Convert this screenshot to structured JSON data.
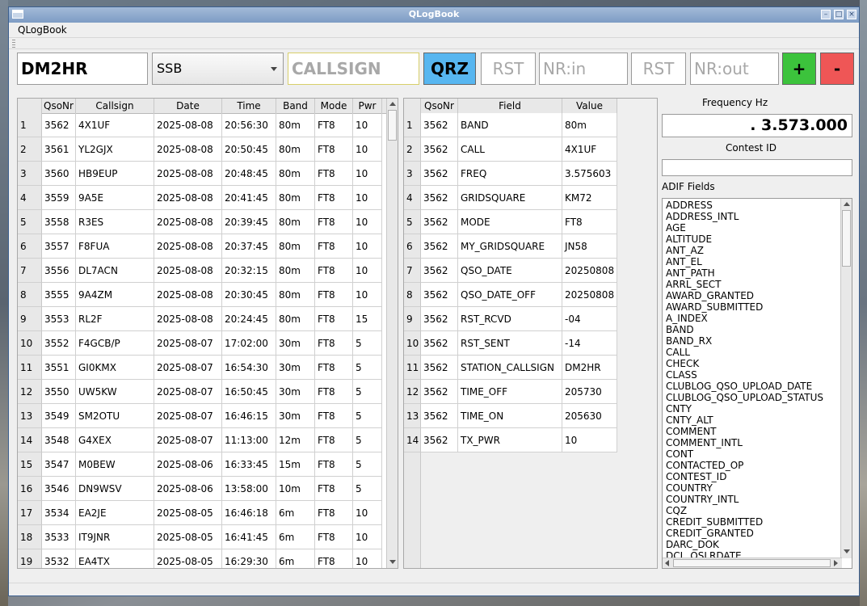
{
  "window": {
    "title": "QLogBook"
  },
  "menu": {
    "items": [
      "QLogBook"
    ]
  },
  "entry": {
    "station_call": "DM2HR",
    "mode_selected": "SSB",
    "callsign_placeholder": "CALLSIGN",
    "qrz_label": "QRZ",
    "rst_in_placeholder": "RST",
    "nr_in_placeholder": "NR:in",
    "rst_out_placeholder": "RST",
    "nr_out_placeholder": "NR:out",
    "add_label": "+",
    "remove_label": "-"
  },
  "log_table": {
    "columns": [
      "QsoNr",
      "Callsign",
      "Date",
      "Time",
      "Band",
      "Mode",
      "Pwr"
    ],
    "rows": [
      [
        "1",
        "3562",
        "4X1UF",
        "2025-08-08",
        "20:56:30",
        "80m",
        "FT8",
        "10"
      ],
      [
        "2",
        "3561",
        "YL2GJX",
        "2025-08-08",
        "20:50:45",
        "80m",
        "FT8",
        "10"
      ],
      [
        "3",
        "3560",
        "HB9EUP",
        "2025-08-08",
        "20:48:45",
        "80m",
        "FT8",
        "10"
      ],
      [
        "4",
        "3559",
        "9A5E",
        "2025-08-08",
        "20:41:45",
        "80m",
        "FT8",
        "10"
      ],
      [
        "5",
        "3558",
        "R3ES",
        "2025-08-08",
        "20:39:45",
        "80m",
        "FT8",
        "10"
      ],
      [
        "6",
        "3557",
        "F8FUA",
        "2025-08-08",
        "20:37:45",
        "80m",
        "FT8",
        "10"
      ],
      [
        "7",
        "3556",
        "DL7ACN",
        "2025-08-08",
        "20:32:15",
        "80m",
        "FT8",
        "10"
      ],
      [
        "8",
        "3555",
        "9A4ZM",
        "2025-08-08",
        "20:30:45",
        "80m",
        "FT8",
        "10"
      ],
      [
        "9",
        "3553",
        "RL2F",
        "2025-08-08",
        "20:24:45",
        "80m",
        "FT8",
        "15"
      ],
      [
        "10",
        "3552",
        "F4GCB/P",
        "2025-08-07",
        "17:02:00",
        "30m",
        "FT8",
        "5"
      ],
      [
        "11",
        "3551",
        "GI0KMX",
        "2025-08-07",
        "16:54:30",
        "30m",
        "FT8",
        "5"
      ],
      [
        "12",
        "3550",
        "UW5KW",
        "2025-08-07",
        "16:50:45",
        "30m",
        "FT8",
        "5"
      ],
      [
        "13",
        "3549",
        "SM2OTU",
        "2025-08-07",
        "16:46:15",
        "30m",
        "FT8",
        "5"
      ],
      [
        "14",
        "3548",
        "G4XEX",
        "2025-08-07",
        "11:13:00",
        "12m",
        "FT8",
        "5"
      ],
      [
        "15",
        "3547",
        "M0BEW",
        "2025-08-06",
        "16:33:45",
        "15m",
        "FT8",
        "5"
      ],
      [
        "16",
        "3546",
        "DN9WSV",
        "2025-08-06",
        "13:58:00",
        "10m",
        "FT8",
        "5"
      ],
      [
        "17",
        "3534",
        "EA2JE",
        "2025-08-05",
        "16:46:18",
        "6m",
        "FT8",
        "10"
      ],
      [
        "18",
        "3533",
        "IT9JNR",
        "2025-08-05",
        "16:41:45",
        "6m",
        "FT8",
        "10"
      ],
      [
        "19",
        "3532",
        "EA4TX",
        "2025-08-05",
        "16:29:30",
        "6m",
        "FT8",
        "10"
      ]
    ]
  },
  "detail_table": {
    "columns": [
      "QsoNr",
      "Field",
      "Value"
    ],
    "rows": [
      [
        "1",
        "3562",
        "BAND",
        "80m"
      ],
      [
        "2",
        "3562",
        "CALL",
        "4X1UF"
      ],
      [
        "3",
        "3562",
        "FREQ",
        "3.575603"
      ],
      [
        "4",
        "3562",
        "GRIDSQUARE",
        "KM72"
      ],
      [
        "5",
        "3562",
        "MODE",
        "FT8"
      ],
      [
        "6",
        "3562",
        "MY_GRIDSQUARE",
        "JN58"
      ],
      [
        "7",
        "3562",
        "QSO_DATE",
        "20250808"
      ],
      [
        "8",
        "3562",
        "QSO_DATE_OFF",
        "20250808"
      ],
      [
        "9",
        "3562",
        "RST_RCVD",
        "-04"
      ],
      [
        "10",
        "3562",
        "RST_SENT",
        "-14"
      ],
      [
        "11",
        "3562",
        "STATION_CALLSIGN",
        "DM2HR"
      ],
      [
        "12",
        "3562",
        "TIME_OFF",
        "205730"
      ],
      [
        "13",
        "3562",
        "TIME_ON",
        "205630"
      ],
      [
        "14",
        "3562",
        "TX_PWR",
        "10"
      ]
    ]
  },
  "side": {
    "freq_label": "Frequency Hz",
    "freq_value": ".   3.573.000",
    "contest_label": "Contest ID",
    "contest_value": "",
    "adif_label": "ADIF Fields",
    "adif_fields": [
      "ADDRESS",
      "ADDRESS_INTL",
      "AGE",
      "ALTITUDE",
      "ANT_AZ",
      "ANT_EL",
      "ANT_PATH",
      "ARRL_SECT",
      "AWARD_GRANTED",
      "AWARD_SUBMITTED",
      "A_INDEX",
      "BAND",
      "BAND_RX",
      "CALL",
      "CHECK",
      "CLASS",
      "CLUBLOG_QSO_UPLOAD_DATE",
      "CLUBLOG_QSO_UPLOAD_STATUS",
      "CNTY",
      "CNTY_ALT",
      "COMMENT",
      "COMMENT_INTL",
      "CONT",
      "CONTACTED_OP",
      "CONTEST_ID",
      "COUNTRY",
      "COUNTRY_INTL",
      "CQZ",
      "CREDIT_SUBMITTED",
      "CREDIT_GRANTED",
      "DARC_DOK",
      "DCL_QSLRDATE"
    ]
  },
  "colors": {
    "qrz": "#57b6f0",
    "add": "#3cc33c",
    "remove": "#ef5656",
    "callsign_border": "#d8cf6a"
  }
}
